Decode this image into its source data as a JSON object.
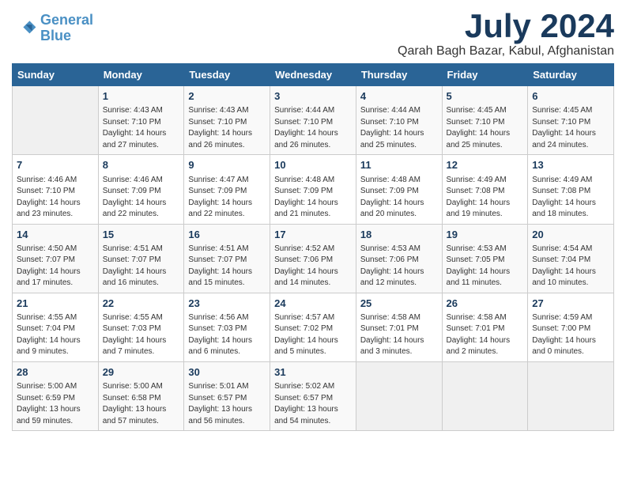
{
  "header": {
    "logo_line1": "General",
    "logo_line2": "Blue",
    "title": "July 2024",
    "subtitle": "Qarah Bagh Bazar, Kabul, Afghanistan"
  },
  "days_of_week": [
    "Sunday",
    "Monday",
    "Tuesday",
    "Wednesday",
    "Thursday",
    "Friday",
    "Saturday"
  ],
  "weeks": [
    [
      {
        "day": "",
        "info": ""
      },
      {
        "day": "1",
        "info": "Sunrise: 4:43 AM\nSunset: 7:10 PM\nDaylight: 14 hours\nand 27 minutes."
      },
      {
        "day": "2",
        "info": "Sunrise: 4:43 AM\nSunset: 7:10 PM\nDaylight: 14 hours\nand 26 minutes."
      },
      {
        "day": "3",
        "info": "Sunrise: 4:44 AM\nSunset: 7:10 PM\nDaylight: 14 hours\nand 26 minutes."
      },
      {
        "day": "4",
        "info": "Sunrise: 4:44 AM\nSunset: 7:10 PM\nDaylight: 14 hours\nand 25 minutes."
      },
      {
        "day": "5",
        "info": "Sunrise: 4:45 AM\nSunset: 7:10 PM\nDaylight: 14 hours\nand 25 minutes."
      },
      {
        "day": "6",
        "info": "Sunrise: 4:45 AM\nSunset: 7:10 PM\nDaylight: 14 hours\nand 24 minutes."
      }
    ],
    [
      {
        "day": "7",
        "info": "Sunrise: 4:46 AM\nSunset: 7:10 PM\nDaylight: 14 hours\nand 23 minutes."
      },
      {
        "day": "8",
        "info": "Sunrise: 4:46 AM\nSunset: 7:09 PM\nDaylight: 14 hours\nand 22 minutes."
      },
      {
        "day": "9",
        "info": "Sunrise: 4:47 AM\nSunset: 7:09 PM\nDaylight: 14 hours\nand 22 minutes."
      },
      {
        "day": "10",
        "info": "Sunrise: 4:48 AM\nSunset: 7:09 PM\nDaylight: 14 hours\nand 21 minutes."
      },
      {
        "day": "11",
        "info": "Sunrise: 4:48 AM\nSunset: 7:09 PM\nDaylight: 14 hours\nand 20 minutes."
      },
      {
        "day": "12",
        "info": "Sunrise: 4:49 AM\nSunset: 7:08 PM\nDaylight: 14 hours\nand 19 minutes."
      },
      {
        "day": "13",
        "info": "Sunrise: 4:49 AM\nSunset: 7:08 PM\nDaylight: 14 hours\nand 18 minutes."
      }
    ],
    [
      {
        "day": "14",
        "info": "Sunrise: 4:50 AM\nSunset: 7:07 PM\nDaylight: 14 hours\nand 17 minutes."
      },
      {
        "day": "15",
        "info": "Sunrise: 4:51 AM\nSunset: 7:07 PM\nDaylight: 14 hours\nand 16 minutes."
      },
      {
        "day": "16",
        "info": "Sunrise: 4:51 AM\nSunset: 7:07 PM\nDaylight: 14 hours\nand 15 minutes."
      },
      {
        "day": "17",
        "info": "Sunrise: 4:52 AM\nSunset: 7:06 PM\nDaylight: 14 hours\nand 14 minutes."
      },
      {
        "day": "18",
        "info": "Sunrise: 4:53 AM\nSunset: 7:06 PM\nDaylight: 14 hours\nand 12 minutes."
      },
      {
        "day": "19",
        "info": "Sunrise: 4:53 AM\nSunset: 7:05 PM\nDaylight: 14 hours\nand 11 minutes."
      },
      {
        "day": "20",
        "info": "Sunrise: 4:54 AM\nSunset: 7:04 PM\nDaylight: 14 hours\nand 10 minutes."
      }
    ],
    [
      {
        "day": "21",
        "info": "Sunrise: 4:55 AM\nSunset: 7:04 PM\nDaylight: 14 hours\nand 9 minutes."
      },
      {
        "day": "22",
        "info": "Sunrise: 4:55 AM\nSunset: 7:03 PM\nDaylight: 14 hours\nand 7 minutes."
      },
      {
        "day": "23",
        "info": "Sunrise: 4:56 AM\nSunset: 7:03 PM\nDaylight: 14 hours\nand 6 minutes."
      },
      {
        "day": "24",
        "info": "Sunrise: 4:57 AM\nSunset: 7:02 PM\nDaylight: 14 hours\nand 5 minutes."
      },
      {
        "day": "25",
        "info": "Sunrise: 4:58 AM\nSunset: 7:01 PM\nDaylight: 14 hours\nand 3 minutes."
      },
      {
        "day": "26",
        "info": "Sunrise: 4:58 AM\nSunset: 7:01 PM\nDaylight: 14 hours\nand 2 minutes."
      },
      {
        "day": "27",
        "info": "Sunrise: 4:59 AM\nSunset: 7:00 PM\nDaylight: 14 hours\nand 0 minutes."
      }
    ],
    [
      {
        "day": "28",
        "info": "Sunrise: 5:00 AM\nSunset: 6:59 PM\nDaylight: 13 hours\nand 59 minutes."
      },
      {
        "day": "29",
        "info": "Sunrise: 5:00 AM\nSunset: 6:58 PM\nDaylight: 13 hours\nand 57 minutes."
      },
      {
        "day": "30",
        "info": "Sunrise: 5:01 AM\nSunset: 6:57 PM\nDaylight: 13 hours\nand 56 minutes."
      },
      {
        "day": "31",
        "info": "Sunrise: 5:02 AM\nSunset: 6:57 PM\nDaylight: 13 hours\nand 54 minutes."
      },
      {
        "day": "",
        "info": ""
      },
      {
        "day": "",
        "info": ""
      },
      {
        "day": "",
        "info": ""
      }
    ]
  ]
}
